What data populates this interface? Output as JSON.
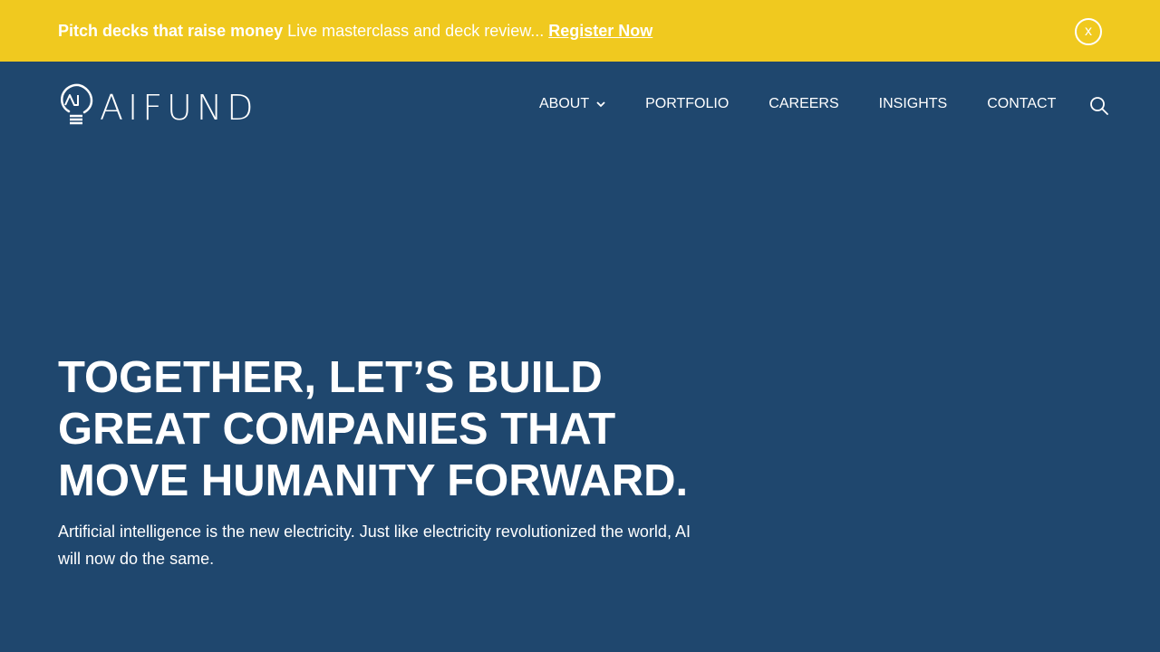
{
  "colors": {
    "banner_bg": "#f0c91f",
    "page_bg": "#1f476e",
    "text": "#ffffff"
  },
  "banner": {
    "headline": "Pitch decks that raise money",
    "text": " Live masterclass and deck review... ",
    "link_label": "Register Now",
    "close_label": "x"
  },
  "header": {
    "logo_text": "AIFUND",
    "logo_icon": "lightbulb-icon",
    "nav": [
      {
        "label": "ABOUT",
        "has_dropdown": true
      },
      {
        "label": "PORTFOLIO"
      },
      {
        "label": "CAREERS"
      },
      {
        "label": "INSIGHTS"
      },
      {
        "label": "CONTACT"
      }
    ],
    "search_icon": "search-icon"
  },
  "hero": {
    "title": "TOGETHER, LET’S BUILD GREAT COMPANIES THAT MOVE HUMANITY FORWARD.",
    "subtitle": "Artificial intelligence is the new electricity. Just like electricity revolutionized the world, AI will now do the same."
  }
}
